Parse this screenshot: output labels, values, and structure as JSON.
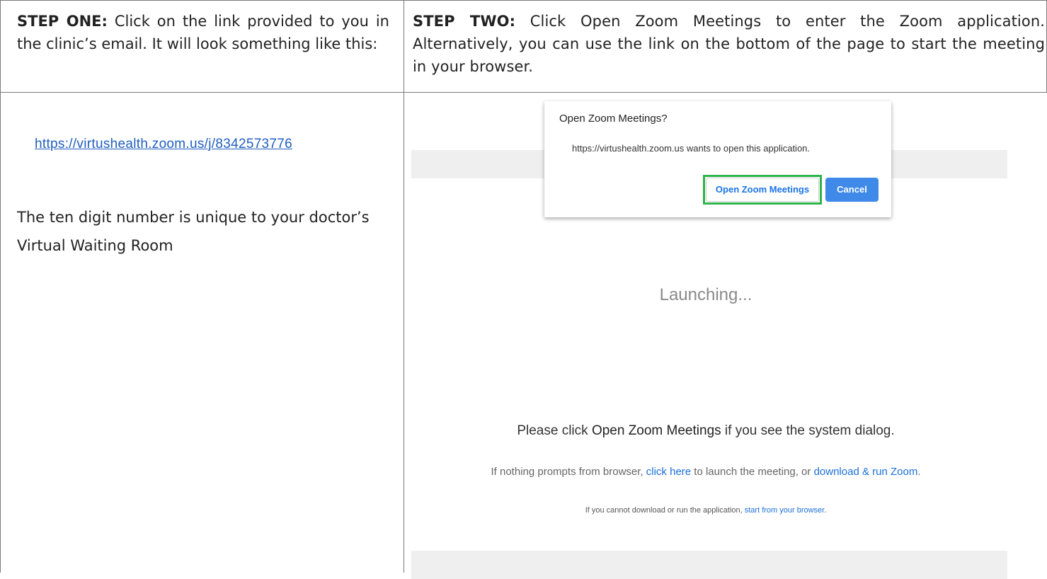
{
  "step_one": {
    "label": "STEP ONE:",
    "text": " Click on the link provided to you in the clinic’s email. It will look something like this:",
    "example_link": "https://virtushealth.zoom.us/j/8342573776",
    "explanation": "The ten digit number is unique to your doctor’s Virtual Waiting Room"
  },
  "step_two": {
    "label": "STEP TWO:",
    "text": " Click Open Zoom Meetings to enter the Zoom application. Alternatively, you can use the link on the bottom of the page to start the meeting in your browser."
  },
  "dialog": {
    "title": "Open Zoom Meetings?",
    "message": "https://virtushealth.zoom.us wants to open this application.",
    "open_label": "Open Zoom Meetings",
    "cancel_label": "Cancel",
    "highlight_color": "#2db44a"
  },
  "zoom_page": {
    "launching": "Launching...",
    "please_prefix": "Please click ",
    "please_strong": "Open Zoom Meetings",
    "please_suffix": " if you see the system dialog.",
    "nothing_prefix": "If nothing prompts from browser, ",
    "click_here": "click here",
    "nothing_middle": " to launch the meeting, or ",
    "download_run": "download & run Zoom",
    "nothing_suffix": ".",
    "cannot_prefix": "If you cannot download or run the application, ",
    "start_browser": "start from your browser",
    "cannot_suffix": ".",
    "link_color": "#1a6fd9"
  }
}
